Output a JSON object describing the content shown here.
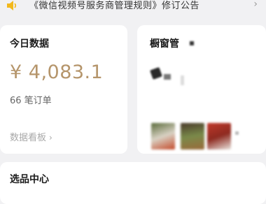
{
  "notice": {
    "text": "《微信视频号服务商管理规则》修订公告",
    "arrow": "›",
    "icon": "speaker-icon",
    "icon_color": "#f2b81c"
  },
  "today": {
    "title": "今日数据",
    "amount": "¥ 4,083.1",
    "orders": "66 笔订单",
    "dashboard_link": "数据看板",
    "dashboard_chevron": "›",
    "amount_color": "#b5956b"
  },
  "window_card": {
    "title": "橱窗管"
  },
  "selection": {
    "title": "选品中心"
  }
}
